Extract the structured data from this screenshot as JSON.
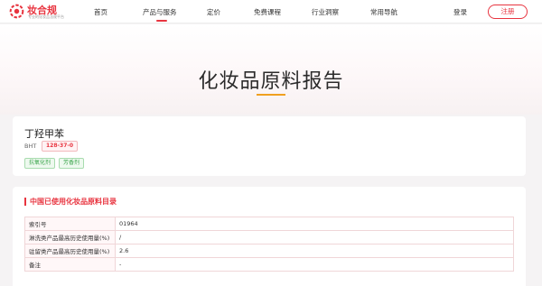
{
  "brand": {
    "name": "妆合规",
    "tagline": "专业的化妆品法规平台",
    "accent": "#e8343f"
  },
  "nav": {
    "items": [
      {
        "label": "首页",
        "active": false
      },
      {
        "label": "产品与服务",
        "active": true
      },
      {
        "label": "定价",
        "active": false
      },
      {
        "label": "免费课程",
        "active": false
      },
      {
        "label": "行业洞察",
        "active": false
      },
      {
        "label": "常用导航",
        "active": false
      }
    ],
    "login": "登录",
    "register": "注册"
  },
  "hero": {
    "title": "化妆品原料报告"
  },
  "material": {
    "name": "丁羟甲苯",
    "abbr": "BHT",
    "cas": "128-37-0",
    "tags": [
      "抗氧化剂",
      "芳香剂"
    ]
  },
  "catalog": {
    "title": "中国已使用化妆品原料目录",
    "rows": [
      {
        "key": "索引号",
        "value": "01964"
      },
      {
        "key": "淋洗类产品最高历史使用量(%)",
        "value": "/"
      },
      {
        "key": "驻留类产品最高历史使用量(%)",
        "value": "2.6"
      },
      {
        "key": "备注",
        "value": "-"
      }
    ]
  }
}
